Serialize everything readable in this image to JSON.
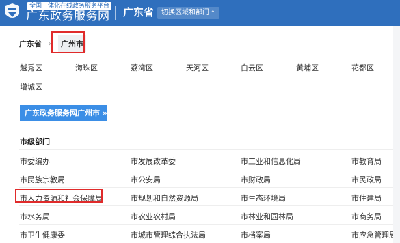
{
  "header": {
    "brand_tagline": "全国一体化在线政务服务平台",
    "brand_name": "广东政务服务网",
    "province": "广东省",
    "switch_label": "切换区域和部门",
    "color": "#2f6fbd"
  },
  "breadcrumb": {
    "province": "广东省",
    "separator": "›",
    "city": "广州市"
  },
  "districts": [
    "越秀区",
    "海珠区",
    "荔湾区",
    "天河区",
    "白云区",
    "黄埔区",
    "花都区",
    "增城区"
  ],
  "city_portal_button": {
    "label": "广东政务服务网广州市",
    "arrows": "»"
  },
  "departments": {
    "title": "市级部门",
    "rows": [
      [
        "市委编办",
        "市发展改革委",
        "市工业和信息化局",
        "市教育局"
      ],
      [
        "市民族宗教局",
        "市公安局",
        "市财政局",
        "市民政局"
      ],
      [
        "市人力资源和社会保障局",
        "市规划和自然资源局",
        "市生态环境局",
        "市住建局"
      ],
      [
        "市水务局",
        "市农业农村局",
        "市林业和园林局",
        "市商务局"
      ],
      [
        "市卫生健康委",
        "市城市管理综合执法局",
        "市档案局",
        "市应急管理局"
      ]
    ]
  },
  "highlight_color": "#e02b2b"
}
